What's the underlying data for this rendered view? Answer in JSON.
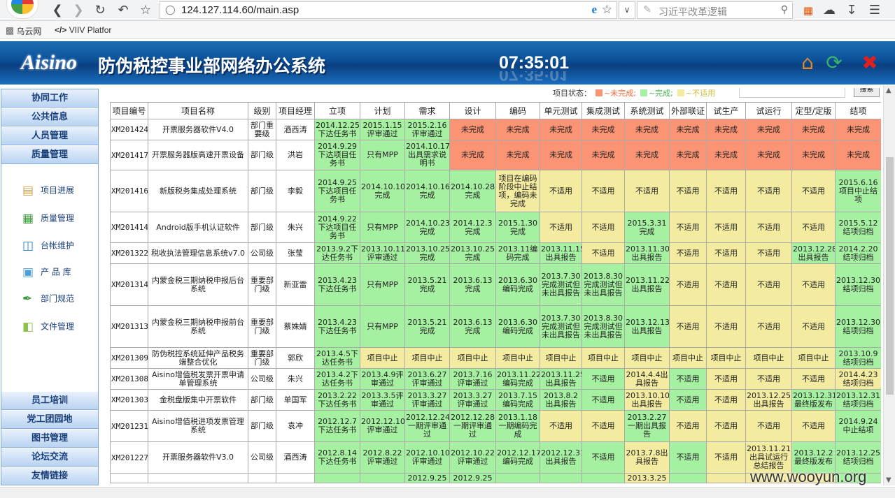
{
  "browser": {
    "url": "124.127.114.60/main.asp",
    "search_placeholder": "习近平改革逻辑",
    "bookmarks": [
      "乌云网",
      "VIIV Platfor"
    ]
  },
  "header": {
    "brand": "Aisino",
    "title": "防伪税控事业部网络办公系统",
    "clock": "07:35:01"
  },
  "sidebar": {
    "top_nav": [
      "协同工作",
      "公共信息",
      "人员管理",
      "质量管理"
    ],
    "items": [
      {
        "label": "项目进展",
        "icon": "book-icon"
      },
      {
        "label": "质量管理",
        "icon": "quality-book-icon"
      },
      {
        "label": "台帐维护",
        "icon": "ledger-icon"
      },
      {
        "label": "产 品 库",
        "icon": "product-box-icon"
      },
      {
        "label": "部门规范",
        "icon": "rules-pen-icon"
      },
      {
        "label": "文件管理",
        "icon": "folder-icon"
      }
    ],
    "bottom_nav": [
      "员工培训",
      "党工团园地",
      "图书管理",
      "论坛交流",
      "友情链接"
    ]
  },
  "status": {
    "label": "项目状态：",
    "legend": [
      {
        "text": "~未完成;",
        "color": "#fb9474"
      },
      {
        "text": "~完成;",
        "color": "#a6f0a2"
      },
      {
        "text": "~不适用",
        "color": "#f3eba0"
      }
    ],
    "button": "搜索"
  },
  "table": {
    "headers": [
      "项目编号",
      "项目名称",
      "级别",
      "项目经理",
      "立项",
      "计划",
      "需求",
      "设计",
      "编码",
      "单元测试",
      "集成测试",
      "系统测试",
      "外部联证",
      "试生产",
      "试运行",
      "定型/定版",
      "结项"
    ],
    "rows": [
      {
        "cells": [
          "XM201424",
          "开票服务器软件V4.0",
          "部门重要级",
          "酒西涛",
          "2014.12.25下达任务书",
          "2015.1.15评审通过",
          "2015.2.16评审通过",
          "未完成",
          "未完成",
          "未完成",
          "未完成",
          "未完成",
          "未完成",
          "未完成",
          "未完成",
          "未完成",
          "未完成"
        ],
        "status": "wwwwgggrrrrrrrrrr"
      },
      {
        "cells": [
          "XM201417",
          "开票服务器版高速开票设备",
          "部门级",
          "洪岩",
          "2014.9.29下达项目任务书",
          "只有MPP",
          "2014.10.17出具需求说明书",
          "未完成",
          "未完成",
          "未完成",
          "未完成",
          "未完成",
          "未完成",
          "未完成",
          "未完成",
          "未完成",
          "未完成"
        ],
        "status": "wwwwgggrrrrrrrrrr"
      },
      {
        "cells": [
          "XM201416",
          "新版税务集成处理系统",
          "部门级",
          "李毅",
          "2014.9.25下达项目任务书",
          "2014.10.10完成",
          "2014.10.16完成",
          "2014.10.28完成",
          "项目在编码阶段中止结项，编码未完成",
          "不适用",
          "不适用",
          "不适用",
          "不适用",
          "不适用",
          "不适用",
          "不适用",
          "2015.6.16项目中止结项"
        ],
        "status": "wwwwggggyyyyyyyyg"
      },
      {
        "cells": [
          "XM201414",
          "Android版手机认证软件",
          "部门级",
          "朱兴",
          "2014.9.22下达项目任务书",
          "只有MPP",
          "2014.10.23完成",
          "2014.12.3完成",
          "2015.1.30完成",
          "不适用",
          "不适用",
          "2015.3.31完成",
          "不适用",
          "不适用",
          "不适用",
          "不适用",
          "2015.5.12结项归档"
        ],
        "status": "wwwwgggggyygyyyyg"
      },
      {
        "cells": [
          "XM201322",
          "税收执法管理信息系统v7.0",
          "公司级",
          "张莹",
          "2013.9.2下达任务书",
          "2013.10.11评审通过",
          "2013.10.25完成",
          "2013.10.25完成",
          "2013.11编码完成",
          "2013.11.15出具报告",
          "不适用",
          "2013.11.30出具报告",
          "不适用",
          "不适用",
          "不适用",
          "2013.12.28出具报告",
          "2014.2.20结项归档"
        ],
        "status": "wwwwggggggygyyygg"
      },
      {
        "cells": [
          "XM201314",
          "内蒙金税三期纳税申报后台系统",
          "重要部门级",
          "新亚雷",
          "2013.4.23下达任务书",
          "只有MPP",
          "2013.5.21完成",
          "2013.6.13完成",
          "2013.6.30编码完成",
          "2013.7.30完成测试但未出具报告",
          "2013.8.30完成测试但未出具报告",
          "2013.11.22出具报告",
          "不适用",
          "不适用",
          "不适用",
          "不适用",
          "2013.12.30结项归档"
        ],
        "status": "wwwwggggggggyyyyg"
      },
      {
        "cells": [
          "XM201313",
          "内蒙金税三期纳税申报前台系统",
          "重要部门级",
          "蔡姝婧",
          "2013.4.23下达任务书",
          "只有MPP",
          "2013.5.21完成",
          "2013.6.13完成",
          "2013.6.30编码完成",
          "2013.7.30完成测试但未出具报告",
          "2013.8.30完成测试但未出具报告",
          "2013.12.13出具报告",
          "不适用",
          "不适用",
          "不适用",
          "不适用",
          "2013.12.30结项归档"
        ],
        "status": "wwwwggggggggyyyyg"
      },
      {
        "cells": [
          "XM201309",
          "防伪税控系统延伸产品税务端整合优化",
          "重要部门级",
          "郭欣",
          "2013.4.5下达任务书",
          "项目中止",
          "项目中止",
          "项目中止",
          "项目中止",
          "项目中止",
          "项目中止",
          "项目中止",
          "项目中止",
          "项目中止",
          "项目中止",
          "项目中止",
          "2013.10.9结项归档"
        ],
        "status": "wwwwgyyyyyyyyyyyg"
      },
      {
        "cells": [
          "XM201308",
          "Aisino增值税发票开票申请单管理系统",
          "公司级",
          "朱兴",
          "2013.4.2下达任务书",
          "2013.4.9评审通过",
          "2013.6.27评审通过",
          "2013.7.16评审通过",
          "2013.11.22编码完成",
          "2013.11.25出具报告",
          "不适用",
          "2014.4.4出具报告",
          "不适用",
          "不适用",
          "不适用",
          "不适用",
          "2014.4.23结项归档"
        ],
        "status": "wwwwgggggggygyyyyg"
      },
      {
        "cells": [
          "XM201303",
          "金税盘版集中开票软件",
          "部门级",
          "单国军",
          "2013.2.22下达任务书",
          "2013.3.5评审通过",
          "2013.3.27评审通过",
          "2013.3.27评审通过",
          "2013.7.15编码完成",
          "2013.8.2出具报告",
          "不适用",
          "2013.10.10出具报告",
          "不适用",
          "不适用",
          "2013.12.25出具报告",
          "2013.12.31最终版发布",
          "2013.12.31结项归档"
        ],
        "status": "wwwwgggggggygyyggg"
      },
      {
        "cells": [
          "XM201231",
          "Aisino增值税进项发票管理系统",
          "部门级",
          "袁冲",
          "2012.12.7下达任务书",
          "2012.12.10评审通过",
          "2012.12.24一期评审通过",
          "2012.12.28一期评审通过",
          "2013.1.18一期编码完成",
          "不适用",
          "不适用",
          "2013.2.27一期出具报告",
          "不适用",
          "不适用",
          "不适用",
          "不适用",
          "2014.9.24中止结项"
        ],
        "status": "wwwwgggggyygyyyyg"
      },
      {
        "cells": [
          "XM201227",
          "开票服务器软件V3.0",
          "公司级",
          "酒西涛",
          "2012.8.14下达任务书",
          "2012.8.22评审通过",
          "2012.10.10评审通过",
          "2012.10.22评审通过",
          "2012.12.17编码完成",
          "2012.12.31出具报告",
          "不适用",
          "2013.7.8出具报告",
          "不适用",
          "不适用",
          "2013.11.21出具试运行总结报告",
          "2013.12.2最终版发布",
          "2013.12.25结项归档"
        ],
        "status": "wwwwgggggggygyyggg"
      },
      {
        "cells": [
          "",
          "",
          "",
          "",
          "",
          "",
          "2012.9.25",
          "2012.9.25",
          "",
          "",
          "",
          "2013.3.25",
          "",
          "",
          "",
          "",
          ""
        ],
        "status": "wwwwgggggggygyyyg"
      }
    ]
  },
  "watermark": "www.wooyun.org"
}
